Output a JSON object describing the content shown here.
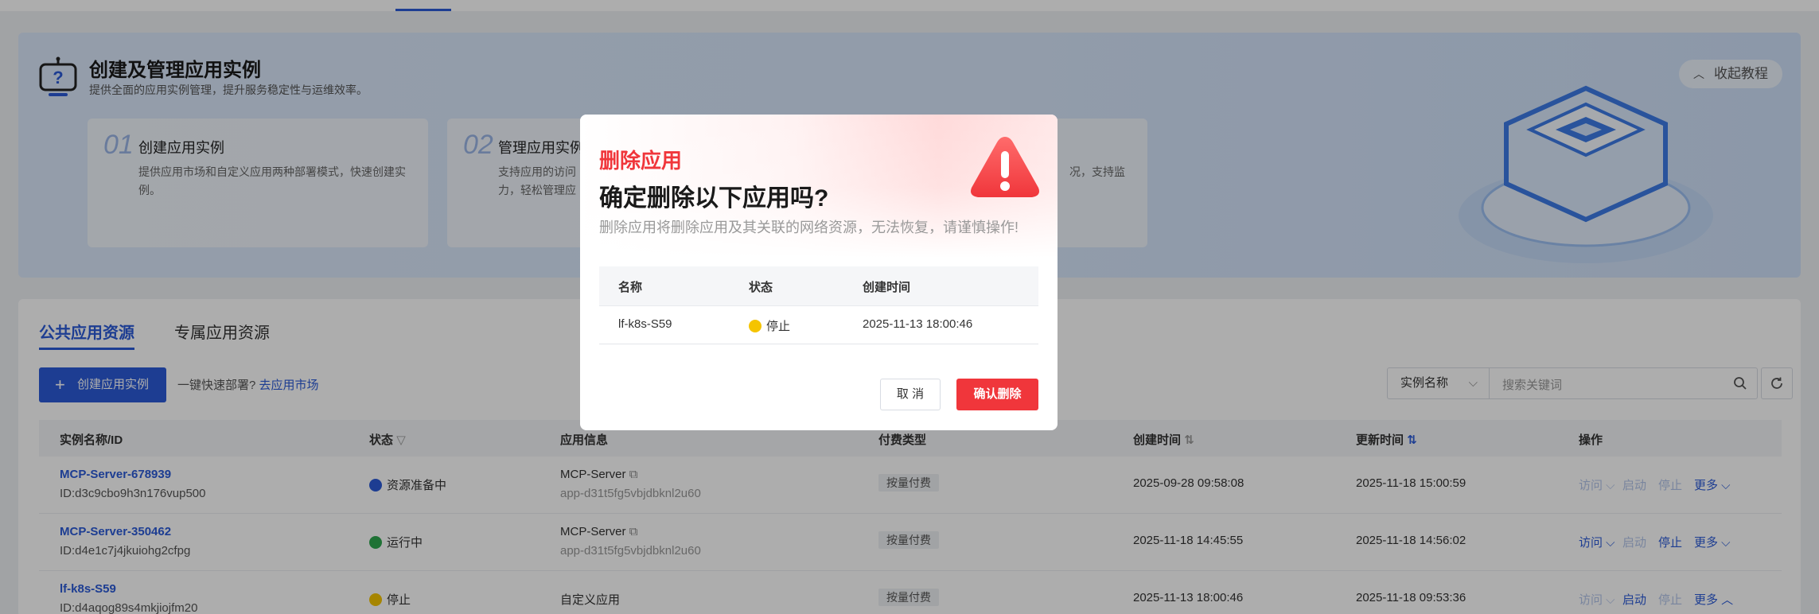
{
  "banner": {
    "title": "创建及管理应用实例",
    "subtitle": "提供全面的应用实例管理，提升服务稳定性与运维效率。",
    "collapse_label": "收起教程",
    "steps": [
      {
        "num": "01",
        "title": "创建应用实例",
        "desc": "提供应用市场和自定义应用两种部署模式，快速创建实例。"
      },
      {
        "num": "02",
        "title": "管理应用实例",
        "desc": "支持应用的访问",
        "desc2": "力，轻松管理应"
      },
      {
        "desc_tail": "况，支持监"
      }
    ]
  },
  "tabs": [
    {
      "label": "公共应用资源",
      "active": true
    },
    {
      "label": "专属应用资源",
      "active": false
    }
  ],
  "toolbar": {
    "create_label": "创建应用实例",
    "quick_text": "一键快速部署?",
    "market_link": "去应用市场",
    "search_field": "实例名称",
    "search_placeholder": "搜索关键词"
  },
  "table": {
    "headers": {
      "name": "实例名称/ID",
      "status": "状态",
      "app": "应用信息",
      "pay": "付费类型",
      "created": "创建时间",
      "updated": "更新时间",
      "ops": "操作"
    },
    "rows": [
      {
        "name": "MCP-Server-678939",
        "id": "ID:d3c9cbo9h3n176vup500",
        "status": "资源准备中",
        "status_color": "#2b5bd7",
        "app": "MCP-Server",
        "app_sub": "app-d31t5fg5vbjdbknl2u60",
        "pay": "按量付费",
        "created": "2025-09-28 09:58:08",
        "updated": "2025-11-18 15:00:59",
        "ops": {
          "visit": "访问",
          "start": "启动",
          "stop": "停止",
          "more": "更多"
        }
      },
      {
        "name": "MCP-Server-350462",
        "id": "ID:d4e1c7j4jkuiohg2cfpg",
        "status": "运行中",
        "status_color": "#2fa84f",
        "app": "MCP-Server",
        "app_sub": "app-d31t5fg5vbjdbknl2u60",
        "pay": "按量付费",
        "created": "2025-11-18 14:45:55",
        "updated": "2025-11-18 14:56:02",
        "ops": {
          "visit": "访问",
          "start": "启动",
          "stop": "停止",
          "more": "更多"
        }
      },
      {
        "name": "lf-k8s-S59",
        "id": "ID:d4aqog89s4mkjiojfm20",
        "status": "停止",
        "status_color": "#f5c400",
        "app": "自定义应用",
        "app_sub": "",
        "pay": "按量付费",
        "created": "2025-11-13 18:00:46",
        "updated": "2025-11-18 09:53:36",
        "ops": {
          "visit": "访问",
          "start": "启动",
          "stop": "停止",
          "more": "更多"
        }
      }
    ]
  },
  "dialog": {
    "kicker": "删除应用",
    "title": "确定删除以下应用吗?",
    "warning": "删除应用将删除应用及其关联的网络资源，无法恢复，请谨慎操作!",
    "headers": {
      "name": "名称",
      "status": "状态",
      "created": "创建时间"
    },
    "row": {
      "name": "lf-k8s-S59",
      "status": "停止",
      "created": "2025-11-13 18:00:46"
    },
    "cancel_label": "取 消",
    "confirm_label": "确认删除",
    "danger_color": "#f0363b"
  }
}
